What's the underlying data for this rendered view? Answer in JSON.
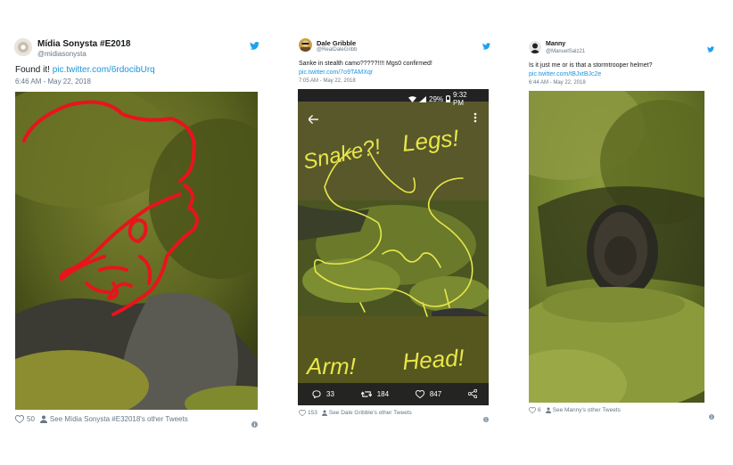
{
  "tweets": [
    {
      "name": "Mídia Sonysta #E2018",
      "handle": "@midiasonysta",
      "text": "Found it!",
      "link": "pic.twitter.com/6rdocibUrq",
      "time": "6:46 AM - May 22, 2018",
      "likes": "50",
      "other": "See Mídia Sonysta #E32018's other Tweets",
      "icons": {
        "bird": "twitter-bird-icon",
        "like": "heart-icon",
        "person": "person-icon",
        "info": "info-icon"
      }
    },
    {
      "name": "Dale Gribble",
      "handle": "@RealDaleGribb",
      "text": "Sanke in stealth camo?????!!!! Mgs0 confirmed!",
      "link": "pic.twitter.com/7o9TAMXqr",
      "time": "7:05 AM - May 22, 2018",
      "likes": "153",
      "other": "See Dale Gribble's other Tweets",
      "phone": {
        "battery": "29%",
        "clock": "9:32 PM",
        "replies": "33",
        "retweets": "184",
        "hearts": "847"
      },
      "drawing_text": [
        "Snake?!",
        "Legs!",
        "Arm!",
        "Head!"
      ]
    },
    {
      "name": "Manny",
      "handle": "@ManuelSalz21",
      "text": "Is it just me or is that a stormtrooper helmet?",
      "link": "pic.twitter.com/tBJxtBJc2e",
      "time": "6:44 AM - May 22, 2018",
      "likes": "6",
      "other": "See Manny's other Tweets"
    }
  ],
  "colors": {
    "twitter_blue": "#1da1f2",
    "link_blue": "#1b95e0",
    "red_scribble": "#e8141b",
    "yellow_scribble": "#e8e64a"
  }
}
